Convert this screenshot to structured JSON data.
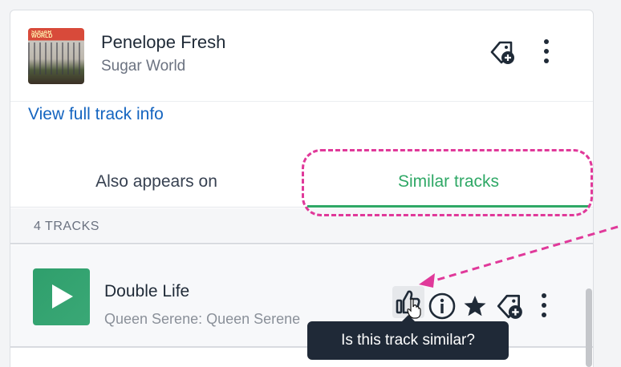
{
  "header": {
    "song_title": "Penelope Fresh",
    "artist": "Sugar World",
    "cover_text": "SUGAR WORLD"
  },
  "links": {
    "view_full": "View full track info"
  },
  "tabs": [
    {
      "label": "Also appears on",
      "active": false
    },
    {
      "label": "Similar tracks",
      "active": true
    }
  ],
  "track_count": "4 TRACKS",
  "tracks": [
    {
      "title": "Double Life",
      "artist": "Queen Serene: Queen Serene"
    }
  ],
  "tooltip": "Is this track similar?",
  "colors": {
    "accent_green": "#2fa866",
    "link_blue": "#1565c0",
    "highlight_pink": "#e0399a",
    "tooltip_bg": "#1f2937"
  },
  "icons": [
    "tag-plus-icon",
    "kebab-menu-icon",
    "play-icon",
    "thumbs-up-icon",
    "info-icon",
    "star-icon"
  ]
}
